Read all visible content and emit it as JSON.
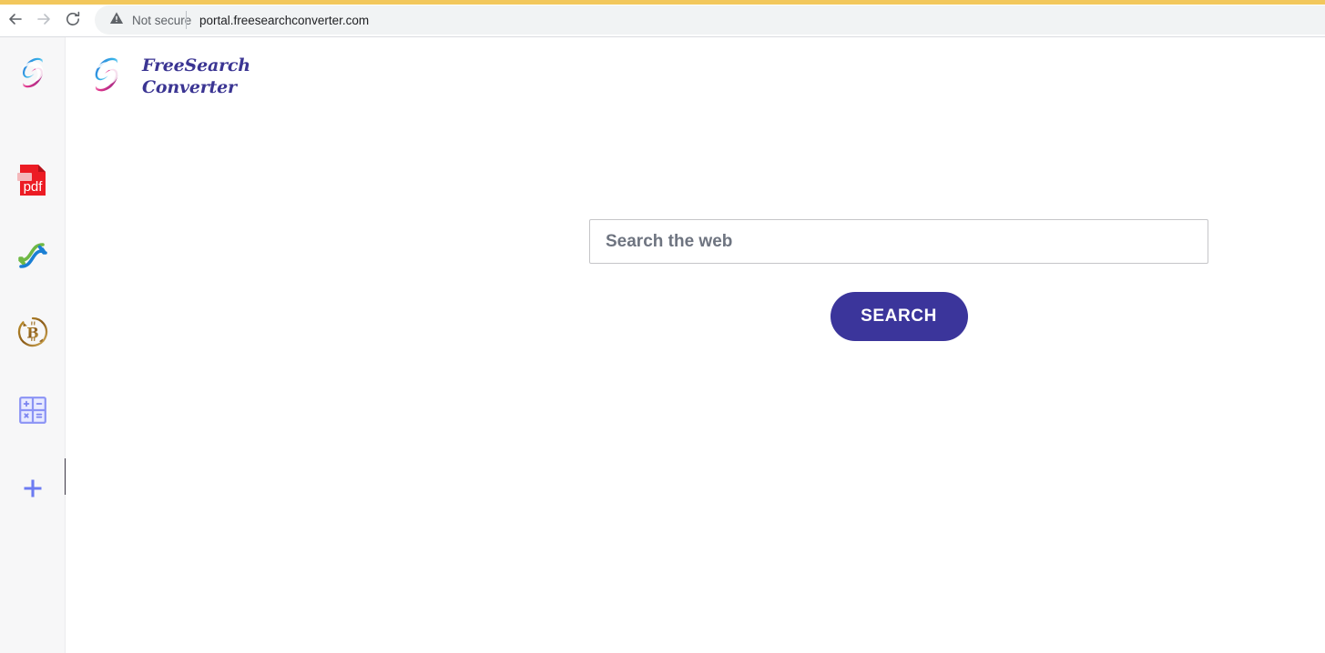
{
  "browser": {
    "back_icon": "arrow-left-icon",
    "forward_icon": "arrow-right-icon",
    "reload_icon": "reload-icon",
    "security_icon": "warning-triangle-icon",
    "security_label": "Not secure",
    "url": "portal.freesearchconverter.com",
    "accent_bar_color": "#f2c75c",
    "omnibox_bg": "#f1f3f4"
  },
  "sidebar": {
    "collapse_icon": "chevron-left-icon",
    "items": [
      {
        "name": "home",
        "icon": "freesearch-swirl-icon",
        "label": "FreeSearch Converter"
      },
      {
        "name": "pdf",
        "icon": "pdf-file-icon",
        "label": "pdf"
      },
      {
        "name": "converter",
        "icon": "convert-arrows-icon",
        "label": "Converter"
      },
      {
        "name": "bitcoin",
        "icon": "bitcoin-icon",
        "label": "Bitcoin"
      },
      {
        "name": "calculator",
        "icon": "calculator-icon",
        "label": "Calculator"
      },
      {
        "name": "add",
        "icon": "plus-icon",
        "label": "Add"
      }
    ]
  },
  "brand": {
    "logo_icon": "freesearch-swirl-icon",
    "line_1": "FreeSearch",
    "line_2": "Converter",
    "text_color": "#3b3593"
  },
  "search": {
    "placeholder": "Search the web",
    "value": "",
    "button_label": "SEARCH",
    "button_color": "#3b359b",
    "input_border_color": "#c5c5c8"
  }
}
